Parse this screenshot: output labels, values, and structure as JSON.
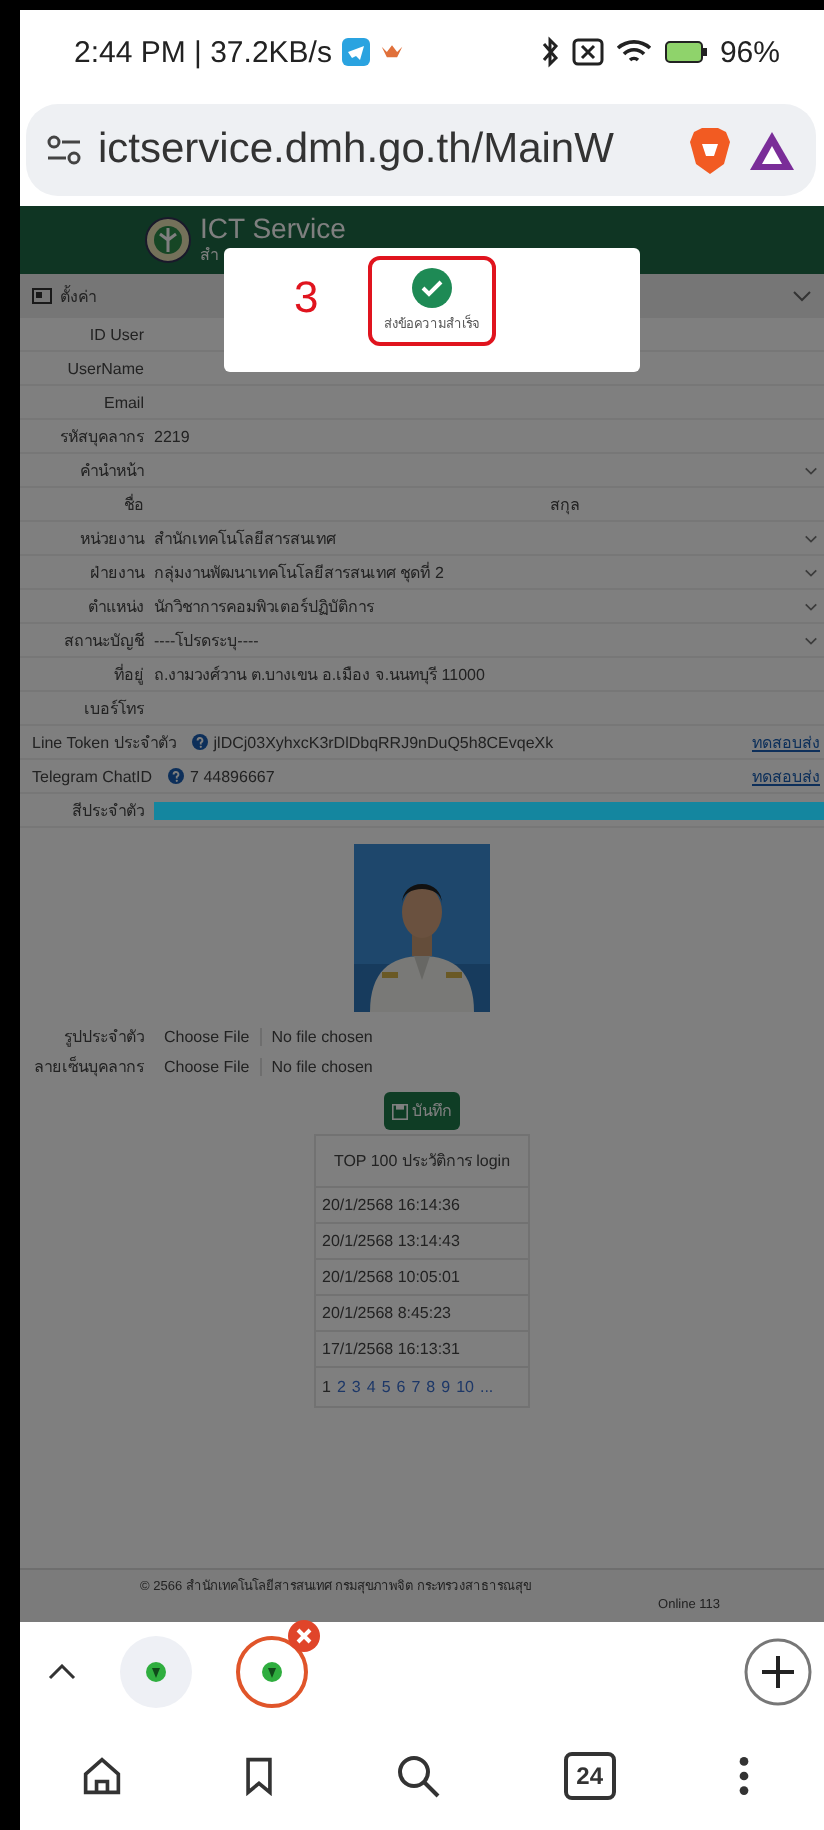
{
  "status_bar": {
    "time": "2:44 PM | 37.2KB/s",
    "battery": "96%"
  },
  "address_bar": {
    "url": "ictservice.dmh.go.th/MainW"
  },
  "site_header": {
    "title": "ICT Service",
    "subtitle": "สำ"
  },
  "section": {
    "title": "ตั้งค่า",
    "expanded": true
  },
  "form_rows": [
    {
      "kind": "text",
      "label": "ID User"
    },
    {
      "kind": "text",
      "label": "UserName"
    },
    {
      "kind": "text",
      "label": "Email"
    },
    {
      "kind": "text",
      "label": "รหัสบุคลากร",
      "value": "2219"
    },
    {
      "kind": "select",
      "label": "คำนำหน้า"
    },
    {
      "kind": "pair",
      "label": "ชื่อ",
      "label_2": "สกุล"
    },
    {
      "kind": "select",
      "label": "หน่วยงาน",
      "value": "สำนักเทคโนโลยีสารสนเทศ"
    },
    {
      "kind": "select",
      "label": "ฝ่ายงาน",
      "value": "กลุ่มงานพัฒนาเทคโนโลยีสารสนเทศ ชุดที่ 2"
    },
    {
      "kind": "select",
      "label": "ตำแหน่ง",
      "value": "นักวิชาการคอมพิวเตอร์ปฏิบัติการ"
    },
    {
      "kind": "select",
      "label": "สถานะบัญชี",
      "value": "----โปรดระบุ----"
    },
    {
      "kind": "text",
      "label": "ที่อยู่",
      "value": "ถ.งามวงศ์วาน ต.บางเขน อ.เมือง จ.นนทบุรี 11000"
    },
    {
      "kind": "text",
      "label": "เบอร์โทร"
    },
    {
      "kind": "token",
      "label": "Line Token ประจำตัว",
      "value": "jlDCj03XyhxcK3rDlDbqRRJ9nDuQ5h8CEvqeXk",
      "link": "ทดสอบส่ง"
    },
    {
      "kind": "token",
      "label": "Telegram ChatID",
      "value": "7 44896667",
      "link": "ทดสอบส่ง"
    },
    {
      "kind": "color",
      "label": "สีประจำตัว",
      "color": "#14869f"
    }
  ],
  "file_rows": [
    {
      "label": "รูปประจำตัว",
      "button": "Choose File",
      "status": "No file chosen"
    },
    {
      "label": "ลายเซ็นบุคลากร",
      "button": "Choose File",
      "status": "No file chosen"
    }
  ],
  "save_button": "บันทึก",
  "login_history": {
    "title": "TOP 100 ประวัติการ login",
    "rows": [
      "20/1/2568 16:14:36",
      "20/1/2568 13:14:43",
      "20/1/2568 10:05:01",
      "20/1/2568 8:45:23",
      "17/1/2568 16:13:31"
    ],
    "pages": [
      {
        "label": "1",
        "selected": true
      },
      {
        "label": "2",
        "selected": false
      },
      {
        "label": "3",
        "selected": false
      },
      {
        "label": "4",
        "selected": false
      },
      {
        "label": "5",
        "selected": false
      },
      {
        "label": "6",
        "selected": false
      },
      {
        "label": "7",
        "selected": false
      },
      {
        "label": "8",
        "selected": false
      },
      {
        "label": "9",
        "selected": false
      },
      {
        "label": "10",
        "selected": false
      },
      {
        "label": "...",
        "selected": false
      }
    ]
  },
  "footer": {
    "copyright": "© 2566 สำนักเทคโนโลยีสารสนเทศ กรมสุขภาพจิต กระทรวงสาธารณสุข",
    "online": "Online 113"
  },
  "alert": {
    "step": "3",
    "message": "ส่งข้อความสำเร็จ"
  },
  "tab_strip": {
    "tabs": [
      {
        "selected": false
      },
      {
        "selected": true
      }
    ]
  },
  "nav_bar": {
    "tab_count": "24"
  }
}
